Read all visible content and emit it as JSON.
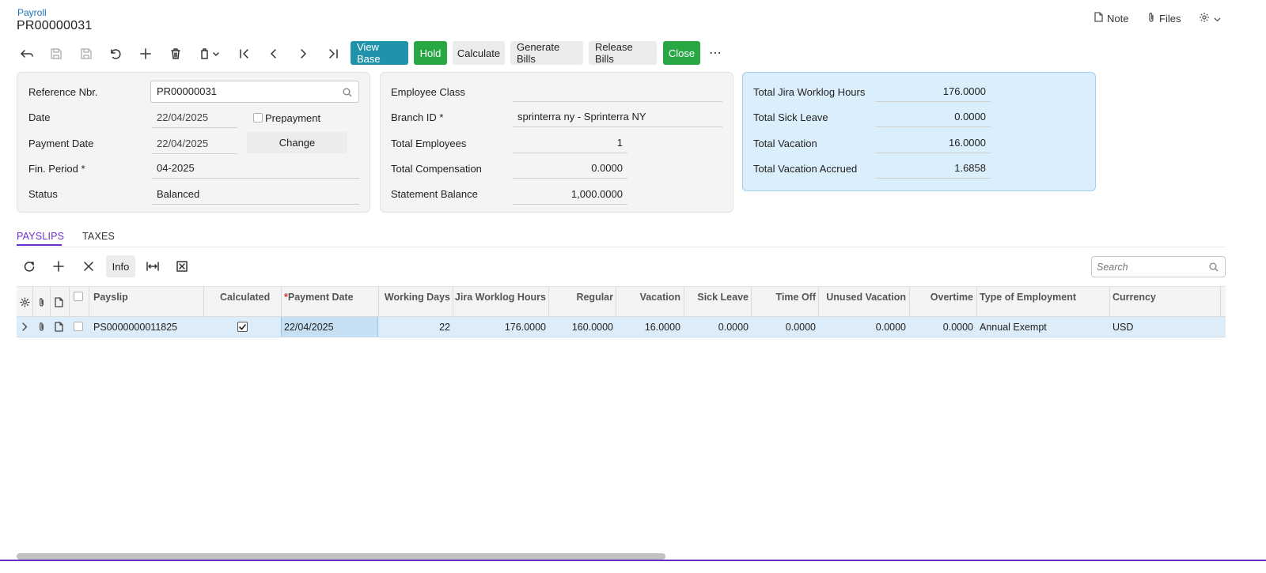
{
  "header": {
    "breadcrumb": "Payroll",
    "title": "PR00000031",
    "note_label": "Note",
    "files_label": "Files"
  },
  "toolbar": {
    "view_base": "View Base",
    "hold": "Hold",
    "calculate": "Calculate",
    "generate_bills": "Generate Bills",
    "release_bills": "Release Bills",
    "close": "Close",
    "more": "⋯"
  },
  "summary": {
    "reference_nbr_label": "Reference Nbr.",
    "reference_nbr": "PR00000031",
    "date_label": "Date",
    "date": "22/04/2025",
    "prepayment_label": "Prepayment",
    "payment_date_label": "Payment Date",
    "payment_date": "22/04/2025",
    "change_button": "Change",
    "fin_period_label": "Fin. Period *",
    "fin_period": "04-2025",
    "status_label": "Status",
    "status": "Balanced"
  },
  "employees": {
    "employee_class_label": "Employee Class",
    "employee_class": "",
    "branch_id_label": "Branch ID *",
    "branch_id": "sprinterra ny - Sprinterra NY",
    "total_employees_label": "Total Employees",
    "total_employees": "1",
    "total_compensation_label": "Total Compensation",
    "total_compensation": "0.0000",
    "statement_balance_label": "Statement Balance",
    "statement_balance": "1,000.0000"
  },
  "totals": {
    "jira_hours_label": "Total Jira Worklog Hours",
    "jira_hours": "176.0000",
    "sick_leave_label": "Total Sick Leave",
    "sick_leave": "0.0000",
    "vacation_label": "Total Vacation",
    "vacation": "16.0000",
    "vacation_accrued_label": "Total Vacation Accrued",
    "vacation_accrued": "1.6858"
  },
  "tabs": [
    {
      "label": "PAYSLIPS",
      "active": true
    },
    {
      "label": "TAXES",
      "active": false
    }
  ],
  "grid_toolbar": {
    "info_label": "Info",
    "search_placeholder": "Search"
  },
  "grid": {
    "columns": {
      "payslip": "Payslip",
      "calculated": "Calculated",
      "payment_date_required": "*",
      "payment_date": "Payment Date",
      "working_days": "Working Days",
      "jira_hours": "Jira Worklog Hours",
      "regular": "Regular",
      "vacation": "Vacation",
      "sick_leave": "Sick Leave",
      "time_off": "Time Off",
      "unused_vacation": "Unused Vacation",
      "overtime": "Overtime",
      "type_of_employment": "Type of Employment",
      "currency": "Currency"
    },
    "rows": [
      {
        "payslip": "PS0000000011825",
        "calculated": true,
        "payment_date": "22/04/2025",
        "working_days": "22",
        "jira_hours": "176.0000",
        "regular": "160.0000",
        "vacation": "16.0000",
        "sick_leave": "0.0000",
        "time_off": "0.0000",
        "unused_vacation": "0.0000",
        "overtime": "0.0000",
        "type_of_employment": "Annual Exempt",
        "currency": "USD"
      }
    ]
  },
  "colors": {
    "accent_purple": "#6a2ecf",
    "teal_button": "#2093ab",
    "green_button": "#28a745",
    "link_blue": "#1e72bd",
    "totals_panel": "#dbeefb"
  }
}
